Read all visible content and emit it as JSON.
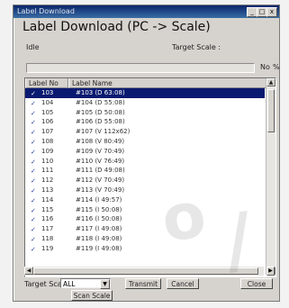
{
  "window": {
    "title": "Label Download",
    "minimize": "_",
    "maximize": "□",
    "close": "x"
  },
  "header": {
    "heading": "Label Download (PC -> Scale)",
    "status": "Idle",
    "target_scale_label": "Target Scale :",
    "progress_no_label": "No",
    "progress_pct_label": "%",
    "progress_fraction": 0
  },
  "list": {
    "columns": [
      "Label No",
      "Label Name"
    ],
    "rows": [
      {
        "check": "✓",
        "no": "103",
        "name": "#103 (D 63:08)",
        "selected": true
      },
      {
        "check": "✓",
        "no": "104",
        "name": "#104 (D 55:08)",
        "selected": false
      },
      {
        "check": "✓",
        "no": "105",
        "name": "#105 (D 50:08)",
        "selected": false
      },
      {
        "check": "✓",
        "no": "106",
        "name": "#106 (D 55:08)",
        "selected": false
      },
      {
        "check": "✓",
        "no": "107",
        "name": "#107 (V 112x62)",
        "selected": false
      },
      {
        "check": "✓",
        "no": "108",
        "name": "#108 (V 80:49)",
        "selected": false
      },
      {
        "check": "✓",
        "no": "109",
        "name": "#109 (V 70:49)",
        "selected": false
      },
      {
        "check": "✓",
        "no": "110",
        "name": "#110 (V 76:49)",
        "selected": false
      },
      {
        "check": "✓",
        "no": "111",
        "name": "#111 (D 49:08)",
        "selected": false
      },
      {
        "check": "✓",
        "no": "112",
        "name": "#112 (V 70:49)",
        "selected": false
      },
      {
        "check": "✓",
        "no": "113",
        "name": "#113 (V 70:49)",
        "selected": false
      },
      {
        "check": "✓",
        "no": "114",
        "name": "#114 (I 49:57)",
        "selected": false
      },
      {
        "check": "✓",
        "no": "115",
        "name": "#115 (I 50:08)",
        "selected": false
      },
      {
        "check": "✓",
        "no": "116",
        "name": "#116 (I 50:08)",
        "selected": false
      },
      {
        "check": "✓",
        "no": "117",
        "name": "#117 (I 49:08)",
        "selected": false
      },
      {
        "check": "✓",
        "no": "118",
        "name": "#118 (I 49:08)",
        "selected": false
      },
      {
        "check": "✓",
        "no": "119",
        "name": "#119 (I 49:08)",
        "selected": false
      }
    ]
  },
  "footer": {
    "target_scale_label": "Target Scale",
    "target_scale_value": "ALL",
    "transmit": "Transmit",
    "cancel": "Cancel",
    "close": "Close",
    "scan_scale": "Scan Scale"
  },
  "icons": {
    "dropdown": "chevron-down-icon",
    "scroll_up": "arrow-up-icon",
    "scroll_down": "arrow-down-icon",
    "scroll_left": "arrow-left-icon",
    "scroll_right": "arrow-right-icon"
  }
}
